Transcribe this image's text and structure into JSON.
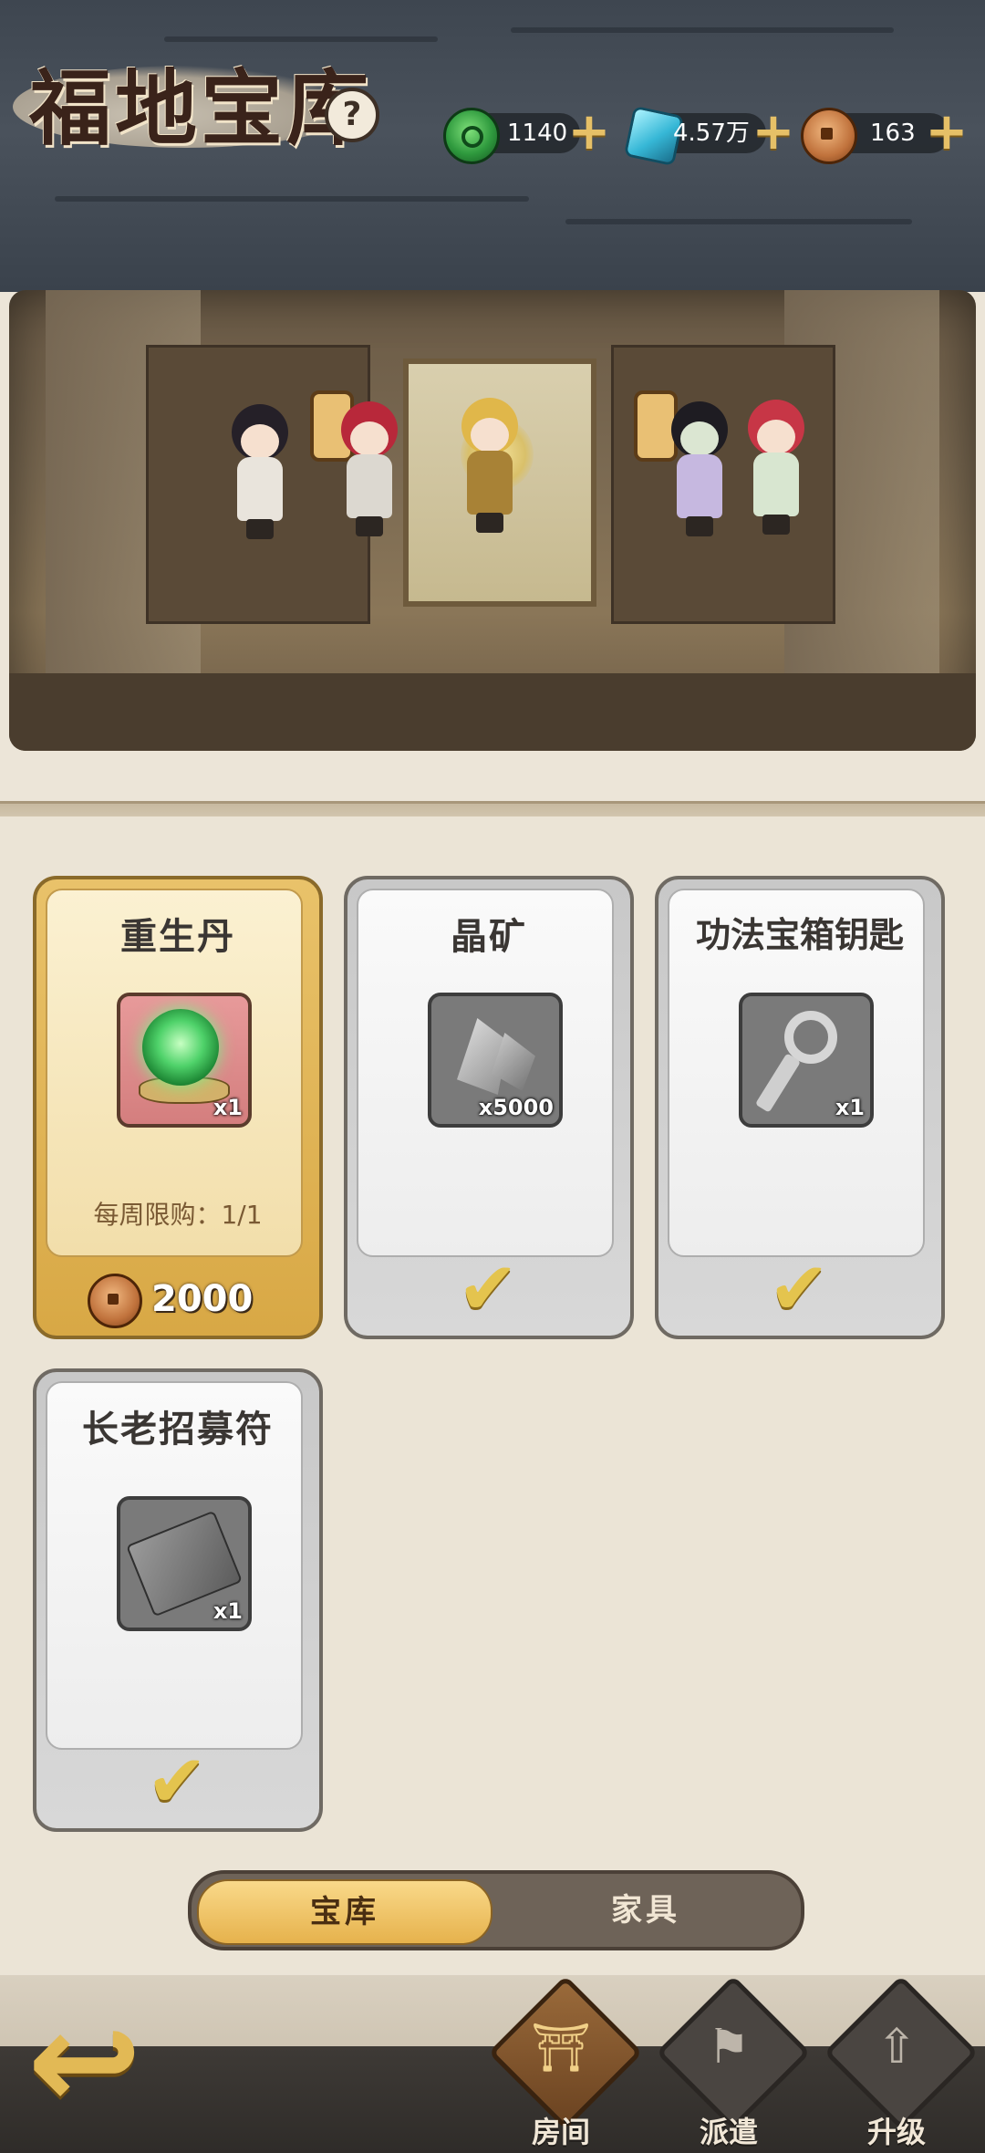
{
  "header": {
    "title": "福地宝库",
    "help_icon": "question-icon",
    "resources": [
      {
        "icon": "jade-token-icon",
        "value": "1140"
      },
      {
        "icon": "crystal-icon",
        "value": "4.57万"
      },
      {
        "icon": "copper-coin-icon",
        "value": "163"
      }
    ]
  },
  "items": [
    {
      "name": "重生丹",
      "icon": "rebirth-pill-icon",
      "qty": "x1",
      "limit": "每周限购：1/1",
      "price": "2000",
      "state": "available"
    },
    {
      "name": "晶矿",
      "icon": "crystal-ore-icon",
      "qty": "x5000",
      "state": "claimed"
    },
    {
      "name": "功法宝箱钥匙",
      "icon": "chest-key-icon",
      "qty": "x1",
      "state": "claimed"
    },
    {
      "name": "长老招募符",
      "icon": "elder-talisman-icon",
      "qty": "x1",
      "state": "claimed"
    }
  ],
  "tabs": {
    "vault": "宝库",
    "furniture": "家具"
  },
  "nav": {
    "room": "房间",
    "dispatch": "派遣",
    "upgrade": "升级"
  },
  "colors": {
    "gold": "#e6b24c",
    "panel": "#ebe4d6",
    "header": "#444c56"
  }
}
